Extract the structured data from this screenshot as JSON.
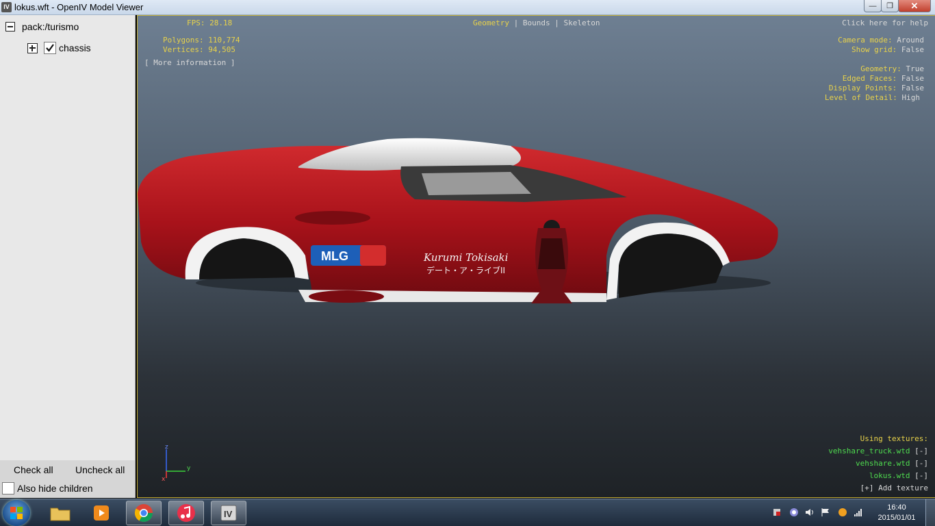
{
  "window": {
    "title": "lokus.wft - OpenIV Model Viewer",
    "app_icon_text": "IV",
    "close_glyph": "✕",
    "max_glyph": "❐",
    "min_glyph": "—"
  },
  "tree": {
    "root_label": "pack:/turismo",
    "child_label": "chassis",
    "child_checked": true
  },
  "left_footer": {
    "check_all": "Check all",
    "uncheck_all": "Uncheck all",
    "also_hide_children": "Also hide children"
  },
  "hud": {
    "fps": "FPS: 28.18",
    "polygons": "Polygons: 110,774",
    "vertices": "Vertices: 94,505",
    "more_info": "[ More information ]",
    "view_modes": {
      "geometry": "Geometry",
      "bounds": "Bounds",
      "skeleton": "Skeleton",
      "separator": "|"
    },
    "help": "Click here for help",
    "settings": [
      {
        "label": "Camera mode:",
        "value": "Around"
      },
      {
        "label": "Show grid:",
        "value": "False"
      },
      {
        "label": "Geometry:",
        "value": "True"
      },
      {
        "label": "Edged Faces:",
        "value": "False"
      },
      {
        "label": "Display Points:",
        "value": "False"
      },
      {
        "label": "Level of Detail:",
        "value": "High"
      }
    ],
    "textures_title": "Using textures:",
    "textures": [
      {
        "name": "vehshare_truck.wtd",
        "remove": "[-]"
      },
      {
        "name": "vehshare.wtd",
        "remove": "[-]"
      },
      {
        "name": "lokus.wtd",
        "remove": "[-]"
      }
    ],
    "add_texture": "[+] Add texture",
    "axis_z": "z",
    "axis_y": "y",
    "axis_x": "x"
  },
  "model": {
    "decal_brand": "MLG",
    "decal_name": "Kurumi Tokisaki",
    "decal_subtitle": "デート・ア・ライブII"
  },
  "taskbar": {
    "clock_time": "16:40",
    "clock_date": "2015/01/01"
  },
  "colors": {
    "hud_yellow": "#e8d24a",
    "hud_green": "#4fdc4f",
    "car_red": "#b0151a",
    "viewport_border": "#c8b23a"
  }
}
